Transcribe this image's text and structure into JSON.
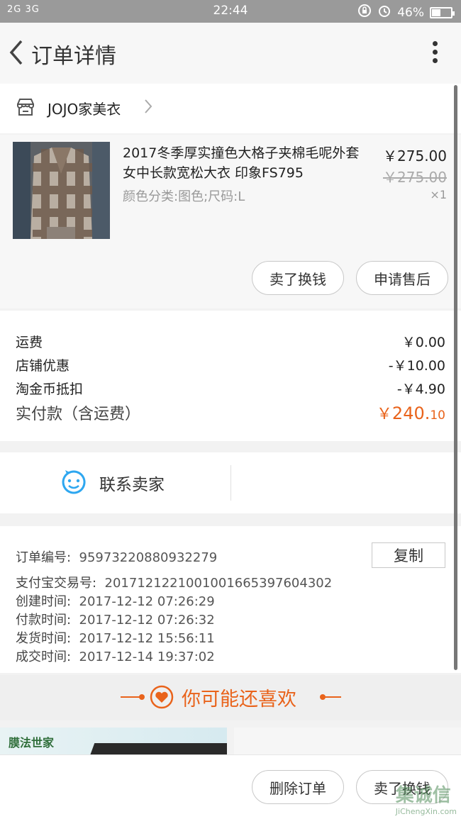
{
  "status_bar": {
    "signal": "2G 3G",
    "time": "22:44",
    "battery_text": "46%",
    "battery_level": 0.46
  },
  "nav": {
    "title": "订单详情"
  },
  "shop": {
    "name": "JOJO家美衣"
  },
  "product": {
    "title": "2017冬季厚实撞色大格子夹棉毛呢外套女中长款宽松大衣 印象FS795",
    "sku": "颜色分类:图色;尺码:L",
    "price": "￥275.00",
    "original_price": "￥275.00",
    "quantity": "×1",
    "actions": {
      "sell_for_cash": "卖了换钱",
      "after_sales": "申请售后"
    }
  },
  "summary": {
    "shipping_label": "运费",
    "shipping_value": "￥0.00",
    "shop_discount_label": "店铺优惠",
    "shop_discount_value": "-￥10.00",
    "coin_label": "淘金币抵扣",
    "coin_value": "-￥4.90",
    "total_label": "实付款（含运费）",
    "total_currency": "￥",
    "total_int": "240.",
    "total_dec": "10"
  },
  "contact": {
    "label": "联系卖家"
  },
  "order_info": {
    "order_no_label": "订单编号:",
    "order_no": "95973220880932279",
    "copy_label": "复制",
    "alipay_label": "支付宝交易号:",
    "alipay_no": "2017121221001001665397604302",
    "created_label": "创建时间:",
    "created": "2017-12-12 07:26:29",
    "paid_label": "付款时间:",
    "paid": "2017-12-12 07:26:32",
    "shipped_label": "发货时间:",
    "shipped": "2017-12-12 15:56:11",
    "done_label": "成交时间:",
    "done": "2017-12-14 19:37:02"
  },
  "recommend": {
    "title": "你可能还喜欢",
    "banner_brand": "膜法世家"
  },
  "bottom": {
    "delete_label": "删除订单",
    "sell_label": "卖了换钱"
  },
  "watermark": {
    "text": "集诚信",
    "sub": "JiChengXin.com"
  },
  "colors": {
    "accent": "#e9631b",
    "contact_icon": "#2ea7f0",
    "status_bar": "#9a9a9a"
  }
}
